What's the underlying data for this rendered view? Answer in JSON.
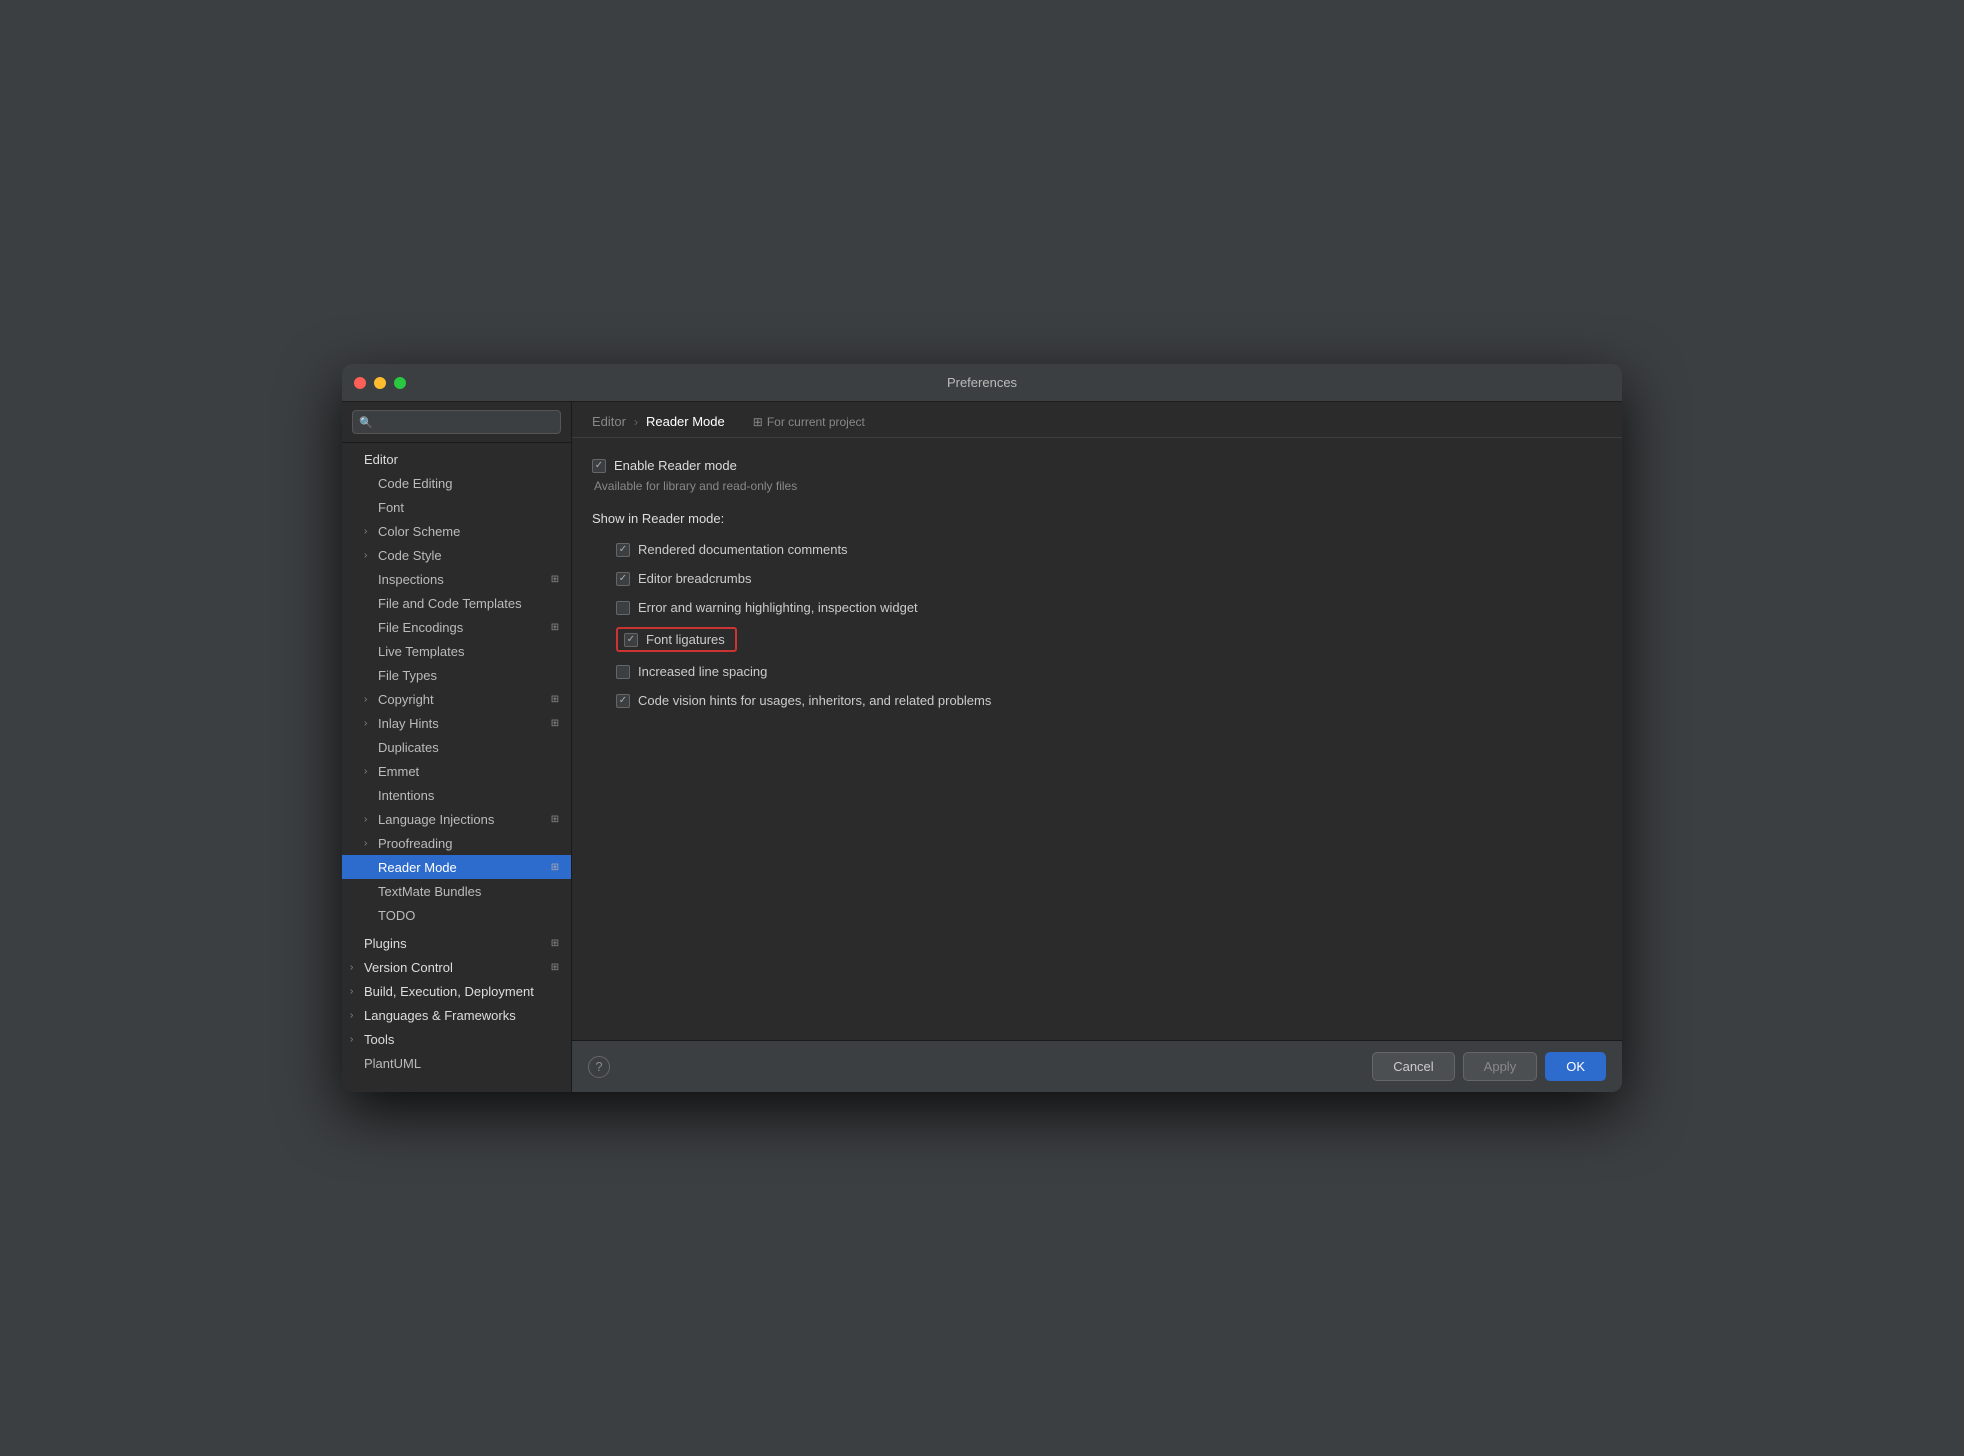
{
  "window": {
    "title": "Preferences"
  },
  "traffic_lights": {
    "close": "close",
    "minimize": "minimize",
    "maximize": "maximize"
  },
  "search": {
    "placeholder": "🔍"
  },
  "sidebar": {
    "items": [
      {
        "id": "editor-header",
        "label": "Editor",
        "type": "section",
        "indent": 0
      },
      {
        "id": "code-editing",
        "label": "Code Editing",
        "type": "leaf",
        "indent": 1
      },
      {
        "id": "font",
        "label": "Font",
        "type": "leaf",
        "indent": 1
      },
      {
        "id": "color-scheme",
        "label": "Color Scheme",
        "type": "expandable",
        "indent": 1
      },
      {
        "id": "code-style",
        "label": "Code Style",
        "type": "expandable",
        "indent": 1
      },
      {
        "id": "inspections",
        "label": "Inspections",
        "type": "leaf-icon",
        "indent": 1
      },
      {
        "id": "file-and-code-templates",
        "label": "File and Code Templates",
        "type": "leaf",
        "indent": 1
      },
      {
        "id": "file-encodings",
        "label": "File Encodings",
        "type": "leaf-icon",
        "indent": 1
      },
      {
        "id": "live-templates",
        "label": "Live Templates",
        "type": "leaf",
        "indent": 1
      },
      {
        "id": "file-types",
        "label": "File Types",
        "type": "leaf",
        "indent": 1
      },
      {
        "id": "copyright",
        "label": "Copyright",
        "type": "expandable-icon",
        "indent": 1
      },
      {
        "id": "inlay-hints",
        "label": "Inlay Hints",
        "type": "expandable-icon",
        "indent": 1
      },
      {
        "id": "duplicates",
        "label": "Duplicates",
        "type": "leaf",
        "indent": 1
      },
      {
        "id": "emmet",
        "label": "Emmet",
        "type": "expandable",
        "indent": 1
      },
      {
        "id": "intentions",
        "label": "Intentions",
        "type": "leaf",
        "indent": 1
      },
      {
        "id": "language-injections",
        "label": "Language Injections",
        "type": "expandable-icon",
        "indent": 1
      },
      {
        "id": "proofreading",
        "label": "Proofreading",
        "type": "expandable",
        "indent": 1
      },
      {
        "id": "reader-mode",
        "label": "Reader Mode",
        "type": "leaf-icon",
        "indent": 1,
        "selected": true
      },
      {
        "id": "textmate-bundles",
        "label": "TextMate Bundles",
        "type": "leaf",
        "indent": 1
      },
      {
        "id": "todo",
        "label": "TODO",
        "type": "leaf",
        "indent": 1
      },
      {
        "id": "plugins-header",
        "label": "Plugins",
        "type": "section-icon",
        "indent": 0
      },
      {
        "id": "version-control",
        "label": "Version Control",
        "type": "expandable-icon",
        "indent": 0,
        "bold": true
      },
      {
        "id": "build-execution",
        "label": "Build, Execution, Deployment",
        "type": "expandable",
        "indent": 0,
        "bold": true
      },
      {
        "id": "languages-frameworks",
        "label": "Languages & Frameworks",
        "type": "expandable",
        "indent": 0,
        "bold": true
      },
      {
        "id": "tools",
        "label": "Tools",
        "type": "expandable",
        "indent": 0,
        "bold": true
      },
      {
        "id": "plantuml",
        "label": "PlantUML",
        "type": "leaf",
        "indent": 0
      }
    ]
  },
  "panel": {
    "breadcrumb_parent": "Editor",
    "breadcrumb_child": "Reader Mode",
    "breadcrumb_sep": "›",
    "for_current_project_icon": "⊞",
    "for_current_project": "For current project",
    "enable_reader_mode_label": "Enable Reader mode",
    "enable_reader_mode_checked": true,
    "subtitle": "Available for library and read-only files",
    "show_in_label": "Show in Reader mode:",
    "options": [
      {
        "id": "rendered-docs",
        "label": "Rendered documentation comments",
        "checked": true,
        "highlighted": false
      },
      {
        "id": "editor-breadcrumbs",
        "label": "Editor breadcrumbs",
        "checked": true,
        "highlighted": false
      },
      {
        "id": "error-warning",
        "label": "Error and warning highlighting, inspection widget",
        "checked": false,
        "highlighted": false
      },
      {
        "id": "font-ligatures",
        "label": "Font ligatures",
        "checked": true,
        "highlighted": true
      },
      {
        "id": "increased-line-spacing",
        "label": "Increased line spacing",
        "checked": false,
        "highlighted": false
      },
      {
        "id": "code-vision",
        "label": "Code vision hints for usages, inheritors, and related problems",
        "checked": true,
        "highlighted": false
      }
    ]
  },
  "bottom_bar": {
    "help_label": "?",
    "cancel_label": "Cancel",
    "apply_label": "Apply",
    "ok_label": "OK"
  }
}
